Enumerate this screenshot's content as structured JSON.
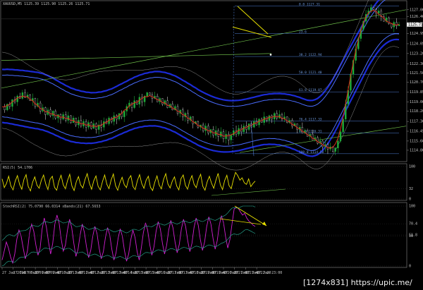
{
  "chart_data": [
    {
      "type": "candlestick",
      "header": "XAUUSD,M5  1125.39 1125.90 1125.26 1125.71",
      "ylim": [
        1114.0,
        1127.6
      ],
      "yticks": [
        "1127.00",
        "1126.40",
        "1125.75",
        "1124.95",
        "1124.05",
        "1123.20",
        "1122.30",
        "1121.50",
        "1120.70",
        "1119.85",
        "1119.00",
        "1118.20",
        "1117.30",
        "1116.45",
        "1115.60",
        "1114.80"
      ],
      "price_label": "1125.71",
      "fibonacci": [
        {
          "label": "0.0  1127.31",
          "price": 1127.31
        },
        {
          "label": "23.6",
          "price": 1124.95
        },
        {
          "label": "38.2  1122.94",
          "price": 1122.94
        },
        {
          "label": "50.0  1121.40",
          "price": 1121.4
        },
        {
          "label": "61.8  1119.87",
          "price": 1119.87
        },
        {
          "label": "76.4  1117.33",
          "price": 1117.33
        },
        {
          "label": "88.6  1116.31",
          "price": 1116.31
        },
        {
          "label": "100.0  1114.50",
          "price": 1114.5
        }
      ],
      "price_path": [
        1118.6,
        1118.3,
        1118.8,
        1118.6,
        1119.2,
        1119.0,
        1119.5,
        1119.3,
        1119.8,
        1119.4,
        1119.6,
        1119.1,
        1119.3,
        1118.6,
        1118.9,
        1118.2,
        1118.5,
        1117.9,
        1118.3,
        1117.8,
        1118.2,
        1117.6,
        1117.9,
        1117.5,
        1117.9,
        1117.4,
        1117.8,
        1117.2,
        1117.6,
        1117.0,
        1117.4,
        1116.9,
        1117.3,
        1116.8,
        1117.2,
        1116.7,
        1117.1,
        1116.6,
        1117.0,
        1116.8,
        1117.3,
        1117.1,
        1117.6,
        1117.3,
        1117.8,
        1117.5,
        1118.0,
        1117.7,
        1118.2,
        1118.6,
        1118.9,
        1118.5,
        1119.1,
        1118.8,
        1119.4,
        1119.0,
        1119.5,
        1119.8,
        1119.6,
        1119.3,
        1119.5,
        1119.0,
        1119.3,
        1118.8,
        1119.1,
        1118.5,
        1118.8,
        1118.3,
        1118.6,
        1118.0,
        1118.3,
        1117.7,
        1118.0,
        1117.4,
        1117.7,
        1117.1,
        1117.3,
        1116.8,
        1117.0,
        1116.5,
        1116.9,
        1116.3,
        1116.6,
        1116.1,
        1116.5,
        1116.0,
        1116.4,
        1115.8,
        1116.2,
        1115.7,
        1116.1,
        1116.5,
        1116.2,
        1116.7,
        1116.4,
        1116.9,
        1116.6,
        1117.1,
        1116.8,
        1117.3,
        1117.0,
        1117.5,
        1117.2,
        1117.7,
        1117.4,
        1117.8,
        1117.5,
        1118.0,
        1117.6,
        1117.9,
        1117.5,
        1117.7,
        1117.2,
        1117.4,
        1116.9,
        1117.1,
        1116.6,
        1116.8,
        1116.3,
        1116.5,
        1116.0,
        1116.2,
        1115.7,
        1115.9,
        1115.4,
        1115.6,
        1115.1,
        1115.3,
        1114.9,
        1115.1,
        1114.7,
        1115.0,
        1115.6,
        1116.4,
        1117.5,
        1118.8,
        1120.0,
        1121.4,
        1122.6,
        1123.6,
        1124.5,
        1125.3,
        1126.0,
        1126.6,
        1126.9,
        1127.2,
        1127.0,
        1126.7,
        1126.9,
        1126.4,
        1126.0,
        1126.3,
        1125.8,
        1125.5,
        1125.9,
        1125.6,
        1125.71
      ],
      "subwindows": [
        {
          "label": "RSI(5) 54.1706",
          "ylim": [
            0,
            100
          ],
          "yticks": [
            "100",
            "32",
            "0"
          ],
          "values": [
            62,
            35,
            48,
            70,
            40,
            28,
            55,
            72,
            45,
            30,
            60,
            75,
            38,
            25,
            52,
            68,
            42,
            33,
            58,
            74,
            46,
            29,
            61,
            70,
            36,
            27,
            55,
            73,
            44,
            31,
            57,
            76,
            40,
            26,
            53,
            69,
            43,
            34,
            60,
            78,
            48,
            30,
            56,
            71,
            39,
            28,
            54,
            74,
            45,
            32,
            59,
            77,
            41,
            27,
            50,
            67,
            44,
            35,
            62,
            72,
            38,
            29,
            57,
            75,
            47,
            33,
            58,
            70,
            36,
            26,
            52,
            71,
            43,
            31,
            60,
            78,
            46,
            34,
            55,
            68,
            40,
            28,
            63,
            74,
            42,
            30,
            56,
            72,
            45,
            35,
            61,
            76,
            39,
            27,
            53,
            70,
            48,
            33,
            58,
            79,
            44,
            29,
            57,
            73,
            41,
            32,
            60,
            82,
            72,
            58,
            65,
            50,
            45,
            62,
            38,
            48,
            55
          ]
        },
        {
          "label": "StochRSI(2) 75.0790 66.0314  xBands(21) 67.5653",
          "ylim": [
            0,
            100
          ],
          "yticks": [
            "100",
            "70.4",
            "51.8",
            "50",
            "0"
          ],
          "values": [
            10,
            25,
            40,
            30,
            15,
            5,
            20,
            45,
            60,
            50,
            30,
            12,
            25,
            55,
            70,
            58,
            35,
            18,
            30,
            62,
            80,
            65,
            40,
            20,
            38,
            70,
            85,
            72,
            45,
            25,
            35,
            60,
            78,
            64,
            38,
            16,
            28,
            52,
            70,
            56,
            32,
            14,
            26,
            50,
            66,
            54,
            30,
            12,
            24,
            48,
            64,
            52,
            28,
            10,
            22,
            46,
            62,
            50,
            26,
            8,
            20,
            44,
            60,
            48,
            24,
            10,
            30,
            56,
            72,
            60,
            36,
            18,
            32,
            58,
            74,
            62,
            38,
            20,
            34,
            60,
            76,
            64,
            40,
            22,
            36,
            62,
            78,
            66,
            42,
            24,
            38,
            64,
            80,
            68,
            44,
            26,
            40,
            66,
            82,
            70,
            46,
            28,
            42,
            68,
            84,
            72,
            48,
            30,
            44,
            70,
            95,
            98,
            96,
            90,
            85,
            88,
            80,
            75,
            72,
            68,
            66
          ]
        }
      ],
      "xticks": [
        "27 Jan 2016",
        "27 Jan 08:20",
        "27 Jan 09:00",
        "27 Jan 09:40",
        "27 Jan 10:20",
        "27 Jan 11:00",
        "27 Jan 11:40",
        "27 Jan 12:20",
        "27 Jan 13:00",
        "27 Jan 13:40",
        "27 Jan 14:20",
        "27 Jan 15:00",
        "27 Jan 15:40",
        "27 Jan 16:20",
        "27 Jan 17:00",
        "27 Jan 17:40",
        "27 Jan 18:20",
        "27 Jan 19:00",
        "27 Jan 19:40",
        "27 Jan 20:20",
        "27 Jan 21:00",
        "27 Jan 21:40",
        "27 Jan 22:20",
        "27 Jan 23:00"
      ],
      "colors": {
        "background": "#000000",
        "up": "#1fae3a",
        "down": "#c0c0c0",
        "band": "#1b2bd6",
        "band_inner": "#4a6cff",
        "trend": "#6fbf4a",
        "fib": "#4f7fd6",
        "signal": "#e8e000",
        "stoch": "#d020d0",
        "rsi": "#e8e000",
        "ma": "#e0301a",
        "xband": "#29b39a"
      }
    }
  ],
  "watermark": "[1274x831] https://upic.me/"
}
